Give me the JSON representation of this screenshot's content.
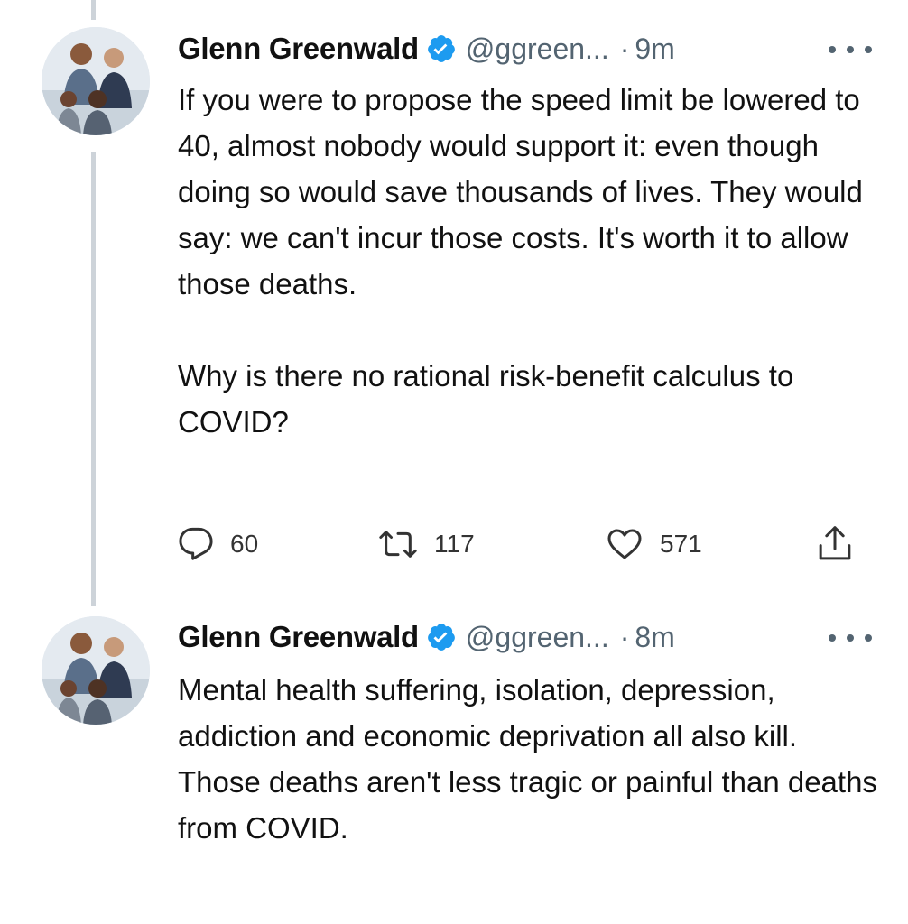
{
  "tweets": [
    {
      "author_name": "Glenn Greenwald",
      "verified": true,
      "handle": "@ggreen...",
      "separator": "·",
      "time": "9m",
      "paragraphs": [
        "If you were to propose the speed limit be lowered to 40, almost nobody would support it: even though doing so would save thousands of lives. They would say: we can't incur those costs. It's worth it to allow those deaths.",
        "Why is there no rational risk-benefit calculus to COVID?"
      ],
      "actions": {
        "reply_count": "60",
        "retweet_count": "117",
        "like_count": "571"
      }
    },
    {
      "author_name": "Glenn Greenwald",
      "verified": true,
      "handle": "@ggreen...",
      "separator": "·",
      "time": "8m",
      "paragraphs": [
        "Mental health suffering, isolation, depression, addiction and economic deprivation all also kill. Those deaths aren't less tragic or painful than deaths from COVID."
      ]
    }
  ],
  "icons": {
    "verified": "verified-badge-icon",
    "more": "more-options-icon",
    "reply": "reply-icon",
    "retweet": "retweet-icon",
    "like": "like-heart-icon",
    "share": "share-icon"
  },
  "colors": {
    "verified_blue": "#1d9bf0",
    "secondary_text": "#536471",
    "thread_line": "#cdd3d9"
  }
}
